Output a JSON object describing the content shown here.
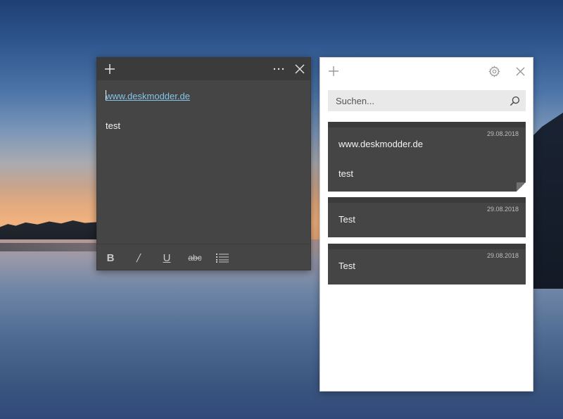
{
  "note_window": {
    "lines": {
      "link": "www.deskmodder.de",
      "text": "test"
    },
    "toolbar": {
      "bold": "B",
      "italic": "/",
      "underline": "U",
      "strikethrough": "abc"
    }
  },
  "list_panel": {
    "search": {
      "placeholder": "Suchen..."
    },
    "notes": [
      {
        "date": "29.08.2018",
        "line1": "www.deskmodder.de",
        "line2": "test"
      },
      {
        "date": "29.08.2018",
        "line1": "Test"
      },
      {
        "date": "29.08.2018",
        "line1": "Test"
      }
    ]
  },
  "colors": {
    "note_background": "#454545",
    "note_titlebar": "#3b3b3b",
    "link": "#86c4e8",
    "panel_background": "#ffffff",
    "search_background": "#e9e9e9"
  },
  "icons": {
    "note_add": "plus-icon",
    "note_menu": "more-icon",
    "note_close": "close-icon",
    "list_add": "plus-icon",
    "list_settings": "gear-icon",
    "list_close": "close-icon",
    "search": "search-icon",
    "list_format": "bullet-list-icon"
  }
}
